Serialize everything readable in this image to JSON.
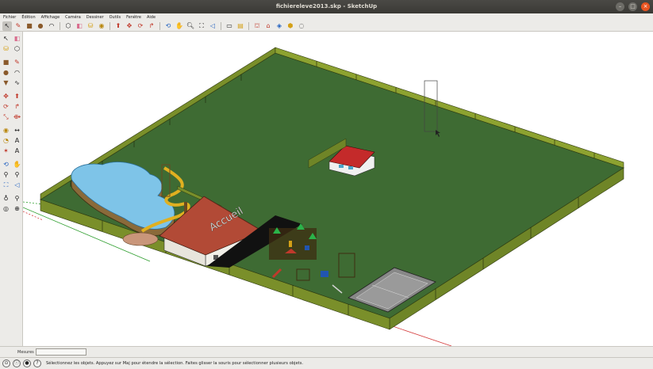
{
  "window": {
    "title": "fichiereleve2013.skp - SketchUp"
  },
  "menubar": {
    "items": [
      "Fichier",
      "Édition",
      "Affichage",
      "Caméra",
      "Dessiner",
      "Outils",
      "Fenêtre",
      "Aide"
    ]
  },
  "toolbar": {
    "icons": [
      "select-icon",
      "pencil-icon",
      "rectangle-icon",
      "circle-icon",
      "arc-icon",
      "make-component-icon",
      "eraser-icon",
      "paint-bucket-icon",
      "tape-measure-icon",
      "push-pull-icon",
      "move-icon",
      "rotate-icon",
      "follow-me-icon",
      "orbit-icon",
      "pan-icon",
      "zoom-icon",
      "zoom-extents-icon",
      "previous-view-icon",
      "next-view-icon",
      "top-view-icon",
      "get-models-icon",
      "share-model-icon",
      "3d-warehouse-icon",
      "extension-warehouse-icon",
      "layout-icon",
      "style-builder-icon"
    ]
  },
  "left_tools": {
    "icons": [
      "select-icon",
      "eraser-icon",
      "paint-bucket-icon",
      "make-component-icon",
      "rectangle-icon",
      "line-icon",
      "circle-icon",
      "arc-icon",
      "polygon-icon",
      "freehand-icon",
      "move-icon",
      "push-pull-icon",
      "rotate-icon",
      "follow-me-icon",
      "scale-icon",
      "offset-icon",
      "tape-measure-icon",
      "dimension-icon",
      "protractor-icon",
      "text-icon",
      "axes-icon",
      "3d-text-icon",
      "orbit-icon",
      "pan-icon",
      "zoom-icon",
      "zoom-window-icon",
      "zoom-extents-icon",
      "previous-view-icon",
      "position-camera-icon",
      "walk-icon",
      "look-around-icon",
      "section-plane-icon"
    ]
  },
  "viewport": {
    "building_label": "Accueil",
    "ground_color": "#3e6b33",
    "wall_color": "#7a8f2a",
    "axis_green": "#2e9e2e",
    "axis_red": "#d43a3a"
  },
  "measures": {
    "label": "Mesures",
    "value": ""
  },
  "status": {
    "icons": [
      "geolocation-icon",
      "credits-icon",
      "user-icon",
      "help-icon"
    ],
    "text": "Sélectionnez les objets. Appuyez sur Maj pour étendre la sélection. Faites glisser la souris pour sélectionner plusieurs objets."
  }
}
